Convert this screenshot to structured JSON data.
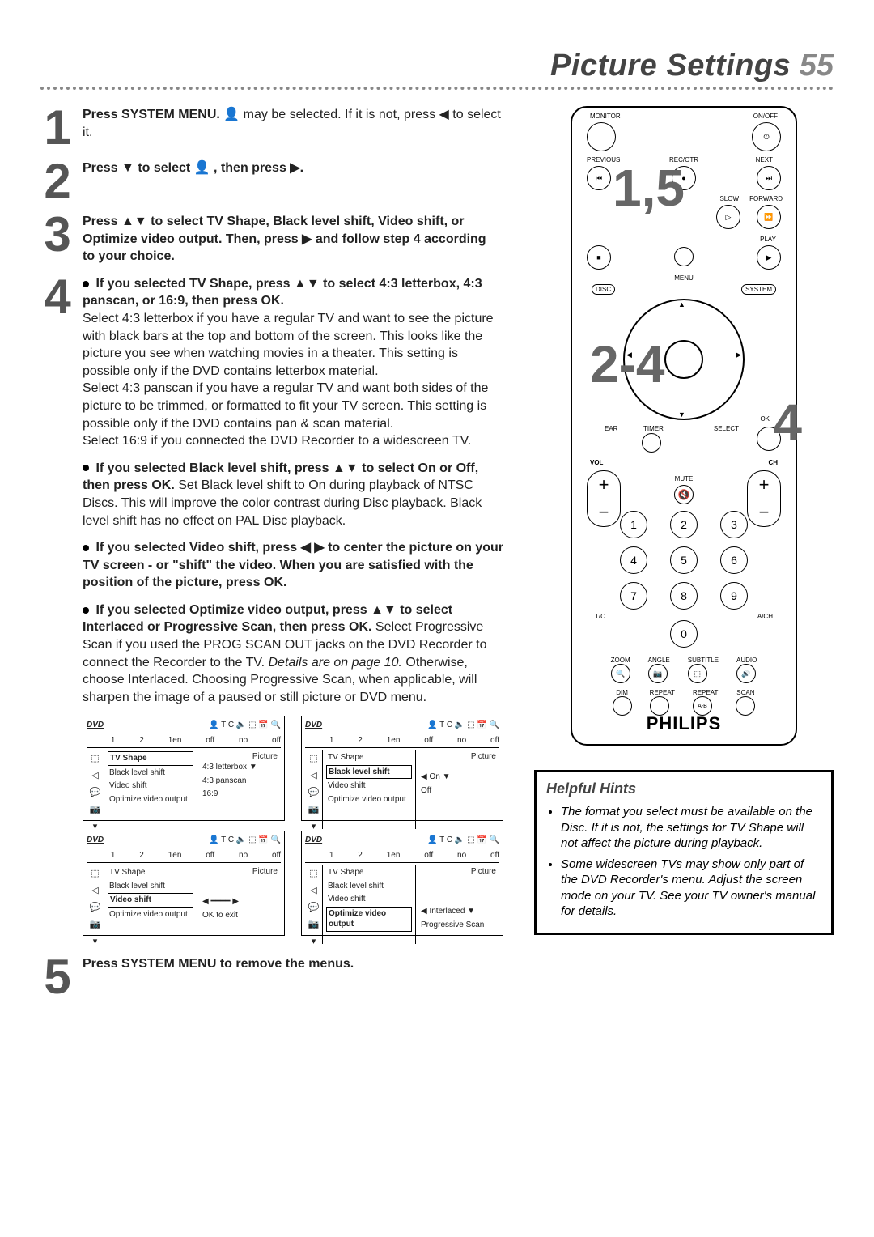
{
  "header": {
    "title": "Picture Settings",
    "page": "55"
  },
  "steps": {
    "s1": {
      "num": "1",
      "bold1": "Press SYSTEM MENU.",
      "text1": " may be selected. If it is not, press ◀ to select it."
    },
    "s2": {
      "num": "2",
      "bold1": "Press ▼ to select  👤 , then press ▶."
    },
    "s3": {
      "num": "3",
      "bold1": "Press ▲▼ to select TV Shape, Black level shift, Video shift, or Optimize video output. Then, press ▶ and follow step 4 according to your choice."
    },
    "s4": {
      "num": "4",
      "p1b": "If you selected TV Shape, press ▲▼ to select 4:3 letterbox, 4:3 panscan, or 16:9, then press OK.",
      "p1": "Select 4:3 letterbox if you have a regular TV and want to see the picture with black bars at the top and bottom of the screen. This looks like the picture you see when watching movies in a theater. This setting is possible only if the DVD contains letterbox material.\nSelect 4:3 panscan if you have a regular TV and want both sides of the picture to be trimmed, or formatted to fit your TV screen. This setting is possible only if the DVD contains pan & scan material.\nSelect 16:9 if you connected the DVD Recorder to a widescreen TV.",
      "p2b": "If you selected Black level shift, press ▲▼ to select On or Off, then press OK.",
      "p2": " Set Black level shift to On during playback of NTSC Discs. This will improve the color contrast during Disc playback. Black level shift has no effect on PAL Disc playback.",
      "p3b": "If you selected Video shift, press ◀ ▶ to center the picture on your TV screen - or \"shift\" the video. When you are satisfied with the position of the picture, press OK.",
      "p4b": "If you selected Optimize video output, press ▲▼ to select Interlaced or Progressive Scan, then press OK.",
      "p4": " Select Progressive Scan if you used the PROG SCAN OUT jacks on the DVD Recorder to connect the Recorder to the TV. ",
      "p4i": "Details are on page 10.",
      "p4b2": " Otherwise, choose Interlaced. Choosing Progressive Scan, when applicable, will sharpen the image of a paused or still picture or DVD menu."
    },
    "s5": {
      "num": "5",
      "bold1": "Press SYSTEM MENU to remove the menus."
    }
  },
  "osd": {
    "toprow": [
      "1",
      "2",
      "1en",
      "off",
      "no",
      "off"
    ],
    "dvd": "DVD",
    "picture": "Picture",
    "items": [
      "TV Shape",
      "Black level shift",
      "Video shift",
      "Optimize video output"
    ],
    "s1v": [
      "4:3 letterbox   ▼",
      "4:3 panscan",
      "16:9"
    ],
    "s2v": [
      "On            ▼",
      "Off"
    ],
    "s3v": [
      "◀  ━━━━  ▶",
      "OK to exit"
    ],
    "s4v": [
      "Interlaced    ▼",
      "Progressive Scan"
    ]
  },
  "remote": {
    "monitor": "MONITOR",
    "onoff": "ON/OFF",
    "previous": "PREVIOUS",
    "recotr": "REC/OTR",
    "next": "NEXT",
    "slow": "SLOW",
    "forward": "FORWARD",
    "play": "PLAY",
    "menu": "MENU",
    "disc": "DISC",
    "system": "SYSTEM",
    "ear": "EAR",
    "timer": "TIMER",
    "ok": "OK",
    "select": "SELECT",
    "vol": "VOL",
    "ch": "CH",
    "mute": "MUTE",
    "tc": "T/C",
    "ach": "A/CH",
    "zoom": "ZOOM",
    "angle": "ANGLE",
    "subtitle": "SUBTITLE",
    "audio": "AUDIO",
    "dim": "DIM",
    "repeat": "REPEAT",
    "repeat2": "REPEAT",
    "scan": "SCAN",
    "ab": "A-B",
    "brand": "PHILIPS",
    "ov15": "1,5",
    "ov24": "2-4",
    "ov4": "4",
    "nums": [
      "1",
      "2",
      "3",
      "4",
      "5",
      "6",
      "7",
      "8",
      "9",
      "0"
    ]
  },
  "hints": {
    "title": "Helpful Hints",
    "h1": "The format you select must be available on the Disc. If it is not, the settings for TV Shape will not affect the picture during playback.",
    "h2": "Some widescreen TVs may show only part of the DVD Recorder's menu. Adjust the screen mode on your TV. See your TV owner's manual for details."
  }
}
